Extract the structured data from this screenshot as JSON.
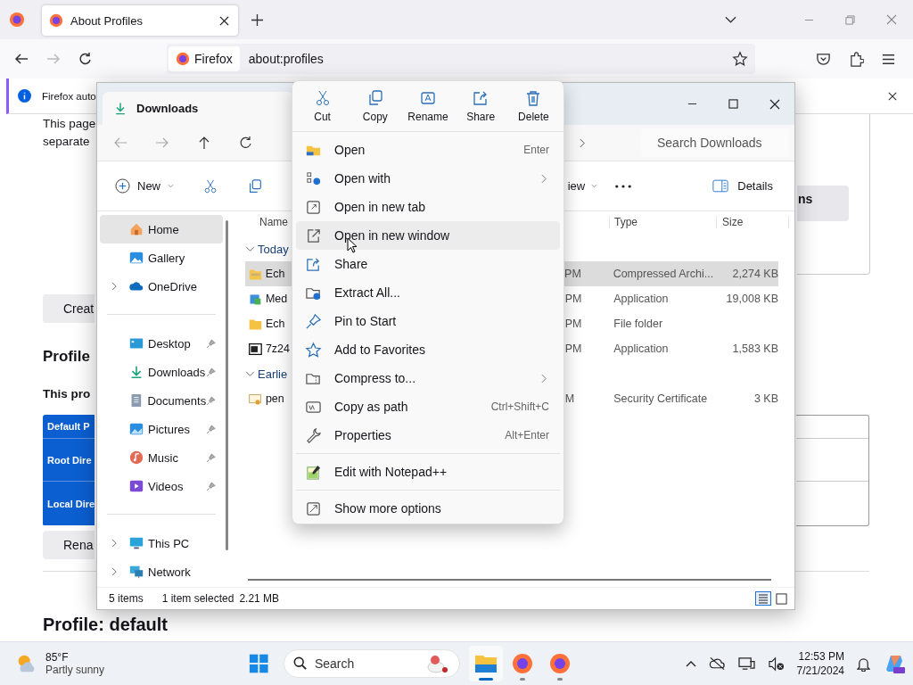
{
  "browser": {
    "tabs": [
      {
        "title": "About Profiles",
        "selected": true
      }
    ],
    "nav_buttons": [
      {
        "kind": "back",
        "disabled": false
      },
      {
        "kind": "forward",
        "disabled": true
      },
      {
        "kind": "reload",
        "disabled": false
      }
    ],
    "identity": "Firefox",
    "url": "about:profiles",
    "notification": "Firefox auto"
  },
  "page": {
    "intro_lines": [
      "This page",
      "separate"
    ],
    "side_button": "ns",
    "create_button": "Creat",
    "heading": "Profile",
    "subheading": "This pro",
    "table_rows": [
      "Default P",
      "Root Dire",
      "Local Dire"
    ],
    "rename_button": "Rena",
    "profile_heading": "Profile: default"
  },
  "explorer": {
    "title": "Downloads",
    "search_placeholder": "Search Downloads",
    "new_label": "New",
    "view_label": "iew",
    "details_label": "Details",
    "nav_groups": [
      [
        {
          "label": "Home",
          "selected": true
        },
        {
          "label": "Gallery",
          "selected": false
        },
        {
          "label": "OneDrive",
          "selected": false,
          "expanded": false
        }
      ],
      [
        {
          "label": "Desktop",
          "selected": false,
          "pinned": true
        },
        {
          "label": "Downloads",
          "selected": false,
          "pinned": true
        },
        {
          "label": "Documents",
          "selected": false,
          "pinned": true
        },
        {
          "label": "Pictures",
          "selected": false,
          "pinned": true
        },
        {
          "label": "Music",
          "selected": false,
          "pinned": true
        },
        {
          "label": "Videos",
          "selected": false,
          "pinned": true
        }
      ],
      [
        {
          "label": "This PC",
          "selected": false,
          "expanded": false
        },
        {
          "label": "Network",
          "selected": false,
          "expanded": false
        }
      ]
    ],
    "columns": [
      "Name",
      "Type",
      "Size"
    ],
    "groups": [
      {
        "label": "Today",
        "expanded": true,
        "rows": [
          {
            "kind": "archive",
            "name": "Ech",
            "date": "PM",
            "type": "Compressed Archi...",
            "size": "2,274 KB",
            "selected": true
          },
          {
            "kind": "installer",
            "name": "Med",
            "date": "PM",
            "type": "Application",
            "size": "19,008 KB",
            "selected": false
          },
          {
            "kind": "folder",
            "name": "Ech",
            "date": "PM",
            "type": "File folder",
            "selected": false
          },
          {
            "kind": "sevenzip",
            "name": "7z24",
            "date": "PM",
            "type": "Application",
            "size": "1,583 KB",
            "selected": false
          }
        ]
      },
      {
        "label": "Earlie",
        "expanded": true,
        "rows": [
          {
            "kind": "certificate",
            "name": "pen",
            "date": "M",
            "type": "Security Certificate",
            "size": "3 KB",
            "selected": false
          }
        ]
      }
    ],
    "status": {
      "count": "5 items",
      "selection": "1 item selected",
      "size": "2.21 MB"
    }
  },
  "context_menu": {
    "actions": [
      "Cut",
      "Copy",
      "Rename",
      "Share",
      "Delete"
    ],
    "sections": [
      [
        {
          "label": "Open",
          "shortcut": "Enter",
          "highlighted": false
        },
        {
          "label": "Open with",
          "submenu": true,
          "highlighted": false
        },
        {
          "label": "Open in new tab",
          "highlighted": false
        },
        {
          "label": "Open in new window",
          "highlighted": true
        },
        {
          "label": "Share",
          "highlighted": false
        },
        {
          "label": "Extract All...",
          "highlighted": false
        },
        {
          "label": "Pin to Start",
          "highlighted": false
        },
        {
          "label": "Add to Favorites",
          "highlighted": false
        },
        {
          "label": "Compress to...",
          "submenu": true,
          "highlighted": false
        },
        {
          "label": "Copy as path",
          "shortcut": "Ctrl+Shift+C",
          "highlighted": false
        },
        {
          "label": "Properties",
          "shortcut": "Alt+Enter",
          "highlighted": false
        }
      ],
      [
        {
          "label": "Edit with Notepad++",
          "highlighted": false
        }
      ],
      [
        {
          "label": "Show more options",
          "highlighted": false
        }
      ]
    ]
  },
  "taskbar": {
    "weather": {
      "temperature": "85°F",
      "condition": "Partly sunny"
    },
    "search_placeholder": "Search",
    "apps": [
      {
        "kind": "explorer",
        "active": true
      },
      {
        "kind": "firefox",
        "active": false
      },
      {
        "kind": "firefox",
        "active": false
      }
    ],
    "time": "12:53 PM",
    "date": "7/21/2024"
  }
}
